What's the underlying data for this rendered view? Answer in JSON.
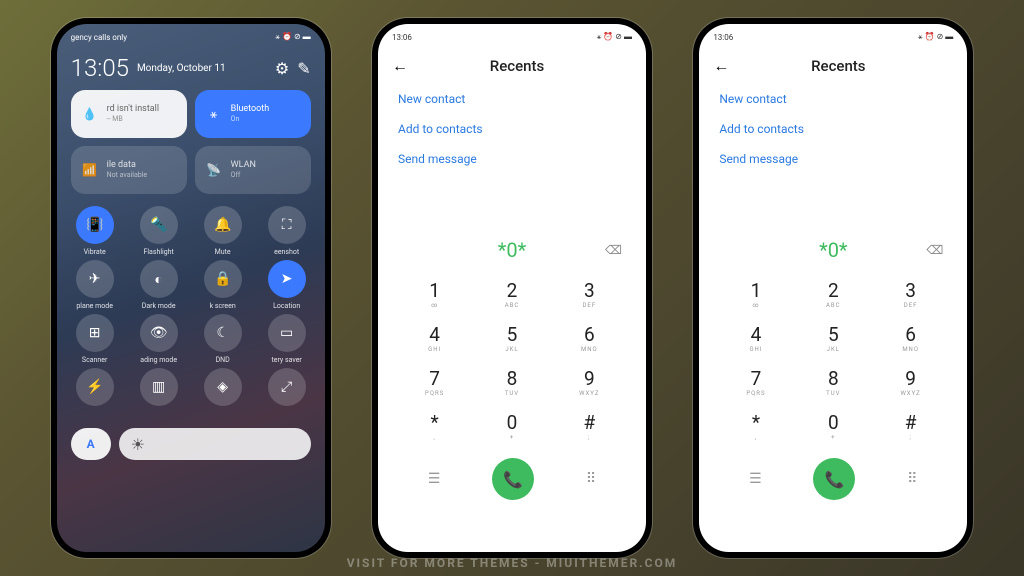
{
  "watermark": "VISIT FOR MORE THEMES - MIUITHEMER.COM",
  "phone1": {
    "statusLeft": "gency calls only",
    "statusRight": "⚹ ⏰ ⊘ ▬",
    "time": "13:05",
    "date": "Monday, October 11",
    "tileInstall": {
      "title": "rd isn't install",
      "sub": "-- MB"
    },
    "tileBluetooth": {
      "title": "Bluetooth",
      "sub": "On"
    },
    "tileData": {
      "title": "ile data",
      "sub": "Not available"
    },
    "tileWlan": {
      "title": "WLAN",
      "sub": "Off"
    },
    "grid": [
      {
        "label": "Vibrate",
        "on": true,
        "glyph": "📳"
      },
      {
        "label": "Flashlight",
        "on": false,
        "glyph": "🔦"
      },
      {
        "label": "Mute",
        "on": false,
        "glyph": "🔔"
      },
      {
        "label": "eenshot",
        "on": false,
        "glyph": "⛶"
      },
      {
        "label": "plane mode",
        "on": false,
        "glyph": "✈"
      },
      {
        "label": "Dark mode",
        "on": false,
        "glyph": "◐"
      },
      {
        "label": "k screen",
        "on": false,
        "glyph": "🔒"
      },
      {
        "label": "Location",
        "on": true,
        "glyph": "➤"
      },
      {
        "label": "Scanner",
        "on": false,
        "glyph": "⊞"
      },
      {
        "label": "ading mode",
        "on": false,
        "glyph": "👁"
      },
      {
        "label": "DND",
        "on": false,
        "glyph": "☾"
      },
      {
        "label": "tery saver",
        "on": false,
        "glyph": "▭"
      },
      {
        "label": "",
        "on": false,
        "glyph": "⚡"
      },
      {
        "label": "",
        "on": false,
        "glyph": "▥"
      },
      {
        "label": "",
        "on": false,
        "glyph": "◈"
      },
      {
        "label": "",
        "on": false,
        "glyph": "⤢"
      }
    ],
    "autoLabel": "A"
  },
  "dialer": {
    "time": "13:06",
    "statusRight": "⚹ ⏰ ⊘ ▬",
    "title": "Recents",
    "links": [
      "New contact",
      "Add to contacts",
      "Send message"
    ],
    "display": "*0*",
    "keys": [
      {
        "n": "1",
        "s": "∞"
      },
      {
        "n": "2",
        "s": "ABC"
      },
      {
        "n": "3",
        "s": "DEF"
      },
      {
        "n": "4",
        "s": "GHI"
      },
      {
        "n": "5",
        "s": "JKL"
      },
      {
        "n": "6",
        "s": "MNO"
      },
      {
        "n": "7",
        "s": "PQRS"
      },
      {
        "n": "8",
        "s": "TUV"
      },
      {
        "n": "9",
        "s": "WXYZ"
      },
      {
        "n": "*",
        "s": ","
      },
      {
        "n": "0",
        "s": "+"
      },
      {
        "n": "#",
        "s": ";"
      }
    ]
  }
}
